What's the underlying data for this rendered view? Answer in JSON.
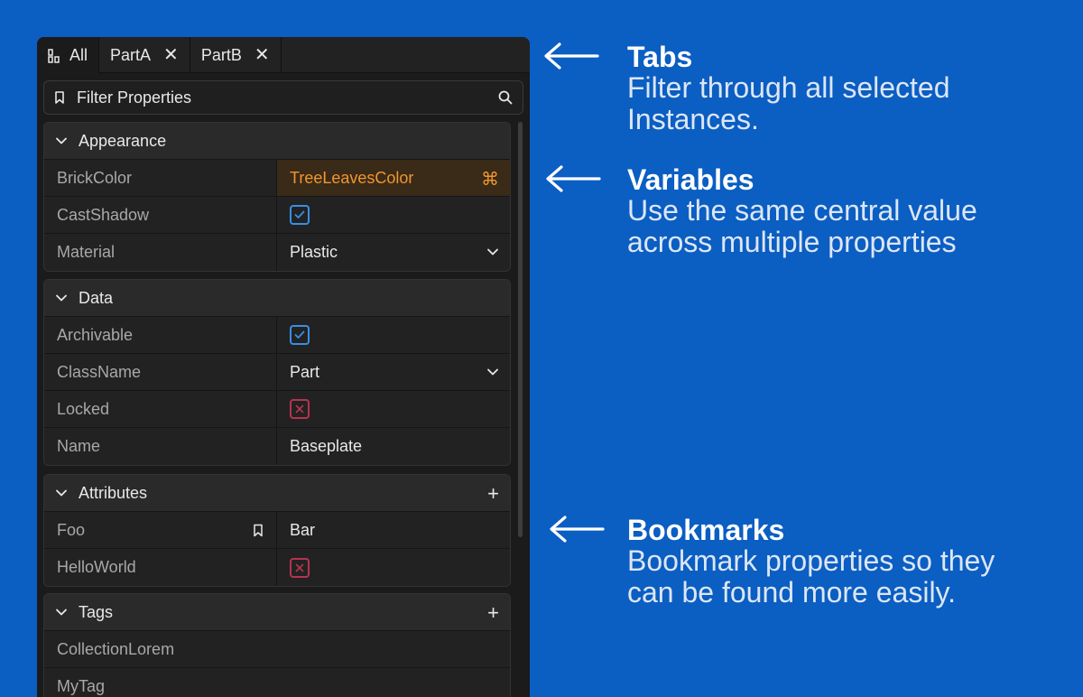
{
  "tabs": [
    {
      "label": "All",
      "icon": "instances-icon",
      "active": true,
      "closable": false
    },
    {
      "label": "PartA",
      "icon": "",
      "active": false,
      "closable": true
    },
    {
      "label": "PartB",
      "icon": "",
      "active": false,
      "closable": true
    }
  ],
  "filter": {
    "placeholder": "Filter Properties"
  },
  "sections": {
    "appearance": {
      "title": "Appearance",
      "rows": {
        "brickcolor": {
          "key": "BrickColor",
          "value": "TreeLeavesColor"
        },
        "castshadow": {
          "key": "CastShadow",
          "checked": true
        },
        "material": {
          "key": "Material",
          "value": "Plastic"
        }
      }
    },
    "data": {
      "title": "Data",
      "rows": {
        "archivable": {
          "key": "Archivable",
          "checked": true
        },
        "classname": {
          "key": "ClassName",
          "value": "Part"
        },
        "locked": {
          "key": "Locked",
          "checked": false
        },
        "name": {
          "key": "Name",
          "value": "Baseplate"
        }
      }
    },
    "attributes": {
      "title": "Attributes",
      "rows": {
        "foo": {
          "key": "Foo",
          "value": "Bar",
          "bookmarked": true
        },
        "helloworld": {
          "key": "HelloWorld",
          "checked": false
        }
      }
    },
    "tags": {
      "title": "Tags",
      "rows": {
        "collection": {
          "key": "CollectionLorem"
        },
        "mytag": {
          "key": "MyTag"
        }
      }
    }
  },
  "annotations": {
    "tabs": {
      "title": "Tabs",
      "desc_line1": "Filter through all selected",
      "desc_line2": "Instances."
    },
    "variables": {
      "title": "Variables",
      "desc_line1": "Use the same central value",
      "desc_line2": "across multiple properties"
    },
    "bookmarks": {
      "title": "Bookmarks",
      "desc_line1": "Bookmark properties so they",
      "desc_line2": "can be found more easily."
    }
  },
  "colors": {
    "background": "#0b5ec2",
    "panel": "#1b1b1b",
    "variable_accent": "#f0962f",
    "checkbox_on": "#3a8ee6",
    "checkbox_off": "#b8334f"
  }
}
